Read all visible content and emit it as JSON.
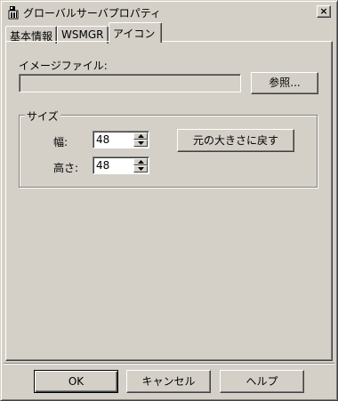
{
  "window": {
    "title": "グローバルサーバプロパティ",
    "close_label": "×"
  },
  "tabs": [
    {
      "label": "基本情報",
      "active": false
    },
    {
      "label": "WSMGR",
      "active": false
    },
    {
      "label": "アイコン",
      "active": true
    }
  ],
  "icon_tab": {
    "image_file_label": "イメージファイル:",
    "image_file_value": "",
    "browse_label": "参照...",
    "size_group": {
      "title": "サイズ",
      "width_label": "幅:",
      "width_value": "48",
      "height_label": "高さ:",
      "height_value": "48",
      "reset_label": "元の大きさに戻す"
    }
  },
  "footer": {
    "ok_label": "OK",
    "cancel_label": "キャンセル",
    "help_label": "ヘルプ"
  }
}
